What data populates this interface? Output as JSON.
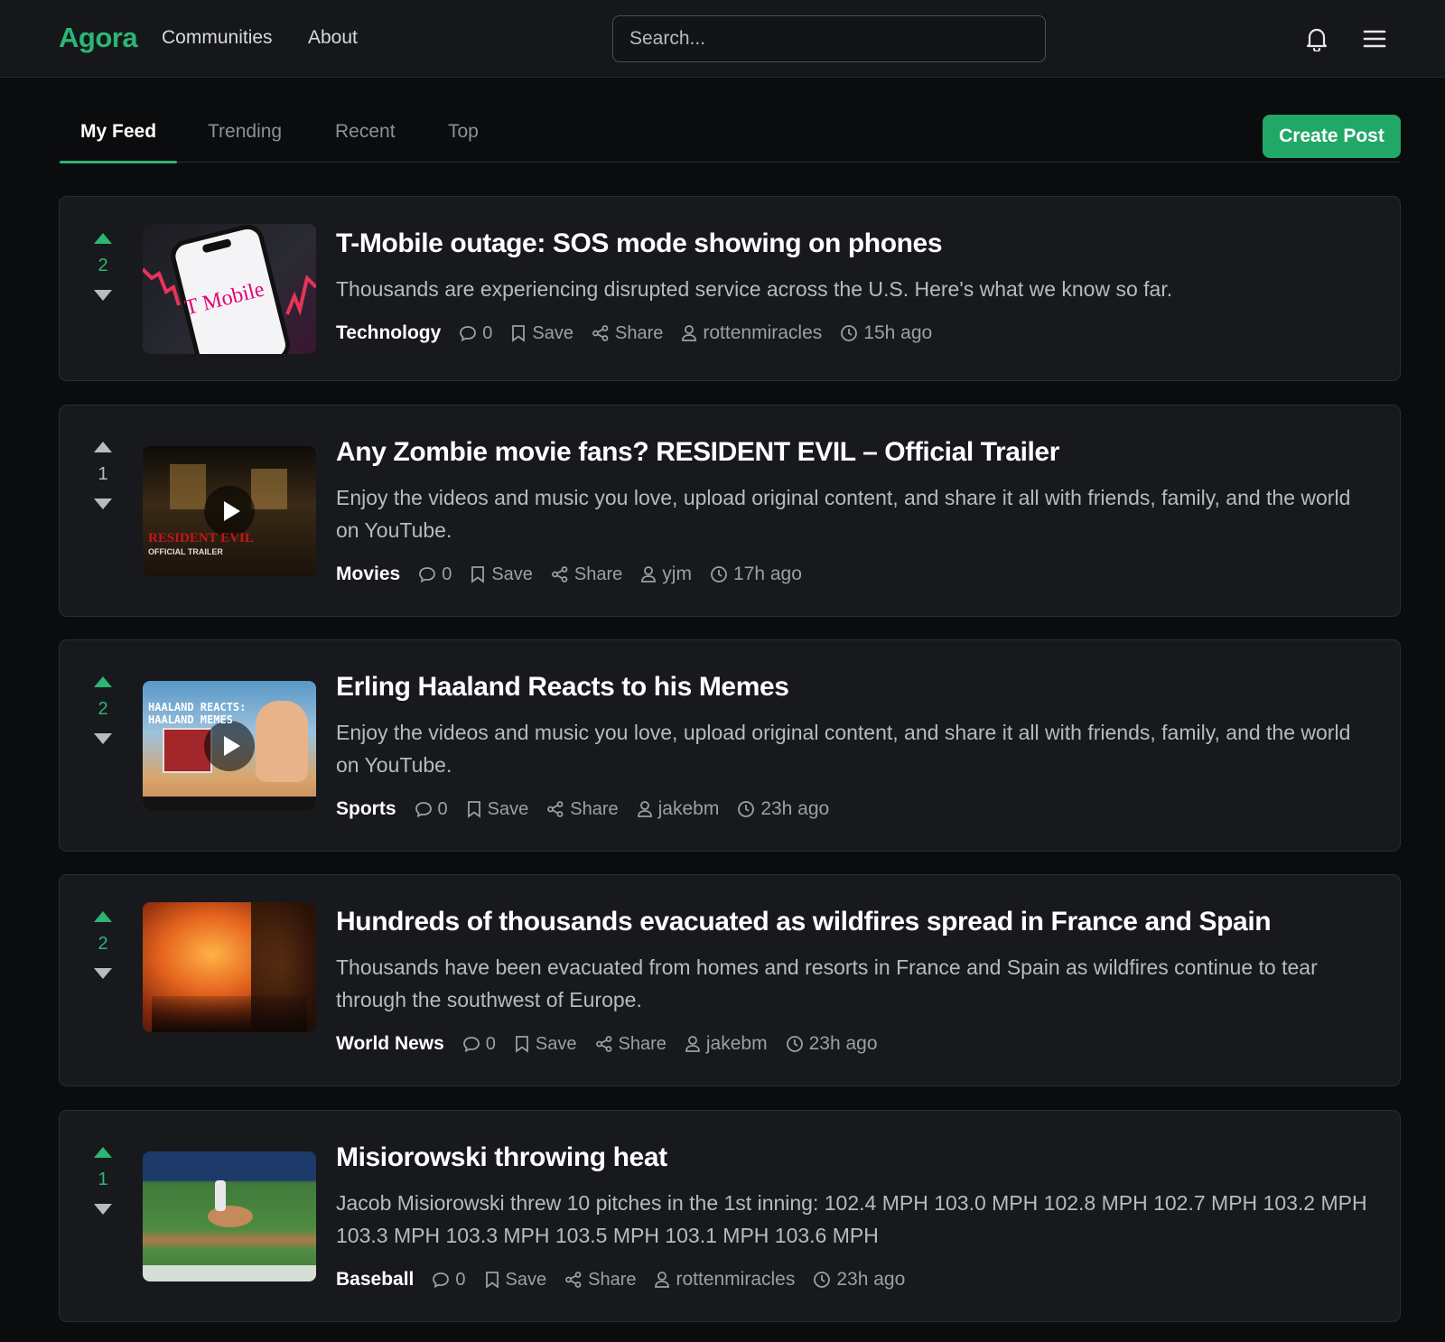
{
  "header": {
    "brand": "Agora",
    "nav": [
      "Communities",
      "About"
    ],
    "search_placeholder": "Search...",
    "icons": [
      "bell-icon",
      "menu-icon"
    ]
  },
  "tabs": [
    {
      "label": "My Feed",
      "active": true
    },
    {
      "label": "Trending",
      "active": false
    },
    {
      "label": "Recent",
      "active": false
    },
    {
      "label": "Top",
      "active": false
    }
  ],
  "create_post_label": "Create Post",
  "actions": {
    "save": "Save",
    "share": "Share"
  },
  "colors": {
    "accent": "#2bb673",
    "background": "#0b0c0e",
    "card": "#17191d"
  },
  "posts": [
    {
      "score": "2",
      "upvoted": true,
      "title": "T-Mobile outage: SOS mode showing on phones",
      "description": "Thousands are experiencing disrupted service across the U.S. Here's what we know so far.",
      "category": "Technology",
      "comments": "0",
      "author": "rottenmiracles",
      "time": "15h ago",
      "thumb_text": "T Mobile"
    },
    {
      "score": "1",
      "upvoted": false,
      "title": "Any Zombie movie fans? RESIDENT EVIL – Official Trailer",
      "description": "Enjoy the videos and music you love, upload original content, and share it all with friends, family, and the world on YouTube.",
      "category": "Movies",
      "comments": "0",
      "author": "yjm",
      "time": "17h ago",
      "thumb_text": "RESIDENT EVIL",
      "thumb_sub": "OFFICIAL TRAILER"
    },
    {
      "score": "2",
      "upvoted": true,
      "title": "Erling Haaland Reacts to his Memes",
      "description": "Enjoy the videos and music you love, upload original content, and share it all with friends, family, and the world on YouTube.",
      "category": "Sports",
      "comments": "0",
      "author": "jakebm",
      "time": "23h ago",
      "thumb_text": "HAALAND REACTS:",
      "thumb_sub": "HAALAND MEMES"
    },
    {
      "score": "2",
      "upvoted": true,
      "title": "Hundreds of thousands evacuated as wildfires spread in France and Spain",
      "description": "Thousands have been evacuated from homes and resorts in France and Spain as wildfires continue to tear through the southwest of Europe.",
      "category": "World News",
      "comments": "0",
      "author": "jakebm",
      "time": "23h ago"
    },
    {
      "score": "1",
      "upvoted": true,
      "title": "Misiorowski throwing heat",
      "description": "Jacob Misiorowski threw 10 pitches in the 1st inning: 102.4 MPH 103.0 MPH 102.8 MPH 102.7 MPH 103.2 MPH 103.3 MPH 103.3 MPH 103.5 MPH 103.1 MPH 103.6 MPH",
      "category": "Baseball",
      "comments": "0",
      "author": "rottenmiracles",
      "time": "23h ago"
    }
  ]
}
